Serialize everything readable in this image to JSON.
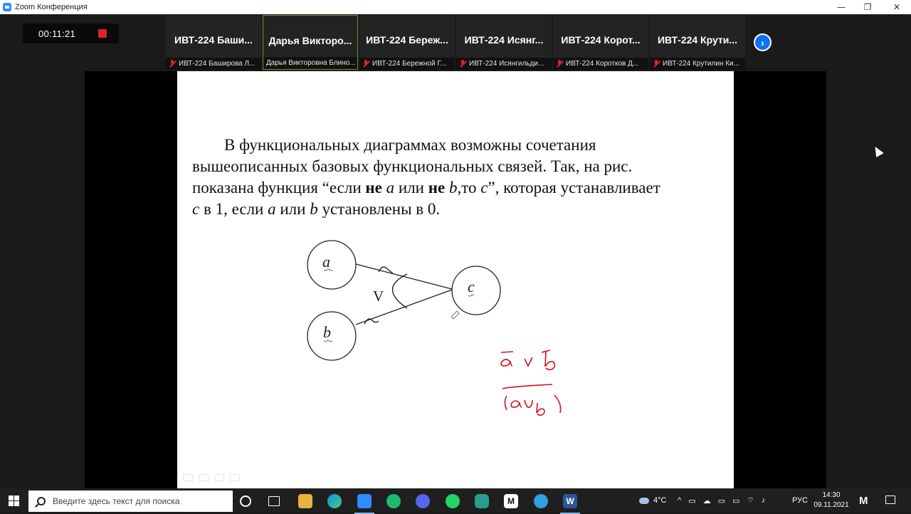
{
  "window": {
    "title": "Zoom Конференция"
  },
  "meeting": {
    "elapsed": "00:11:21"
  },
  "participants": [
    {
      "tile_name": "ИВТ-224  Баши...",
      "label": "ИВТ-224 Баширова Л...",
      "muted": true
    },
    {
      "tile_name": "Дарья  Викторо...",
      "label": "Дарья Викторовна Блино...",
      "muted": false,
      "active": true
    },
    {
      "tile_name": "ИВТ-224  Береж...",
      "label": "ИВТ-224 Бережной Г...",
      "muted": true
    },
    {
      "tile_name": "ИВТ-224  Исянг...",
      "label": "ИВТ-224 Исянгильди...",
      "muted": true
    },
    {
      "tile_name": "ИВТ-224  Корот...",
      "label": "ИВТ-224 Коротков Д...",
      "muted": true
    },
    {
      "tile_name": "ИВТ-224  Крути...",
      "label": "ИВТ-224 Крутилин Ки...",
      "muted": true
    }
  ],
  "slide": {
    "line1": "В функциональных диаграммах возможны сочетания",
    "line2": "вышеописанных базовых функциональных связей. Так, на рис.",
    "line3_a": "показана функция “если ",
    "line3_b": "не",
    "line3_c": " a",
    "line3_d": " или ",
    "line3_e": "не",
    "line3_f": " b",
    "line3_g": ",то ",
    "line3_h": "c",
    "line3_i": "”, которая устанавливает",
    "line4_a": "c",
    "line4_b": " в 1, если ",
    "line4_c": "a",
    "line4_d": " или ",
    "line4_e": "b",
    "line4_f": " установлены в 0.",
    "node_a": "a",
    "node_b": "b",
    "node_c": "c",
    "or_symbol": "V",
    "handwriting_color": "#d4101c"
  },
  "taskbar": {
    "search_placeholder": "Введите здесь текст для поиска",
    "weather": "4°C",
    "language": "РУС",
    "time": "14:30",
    "date": "09.11.2021"
  }
}
